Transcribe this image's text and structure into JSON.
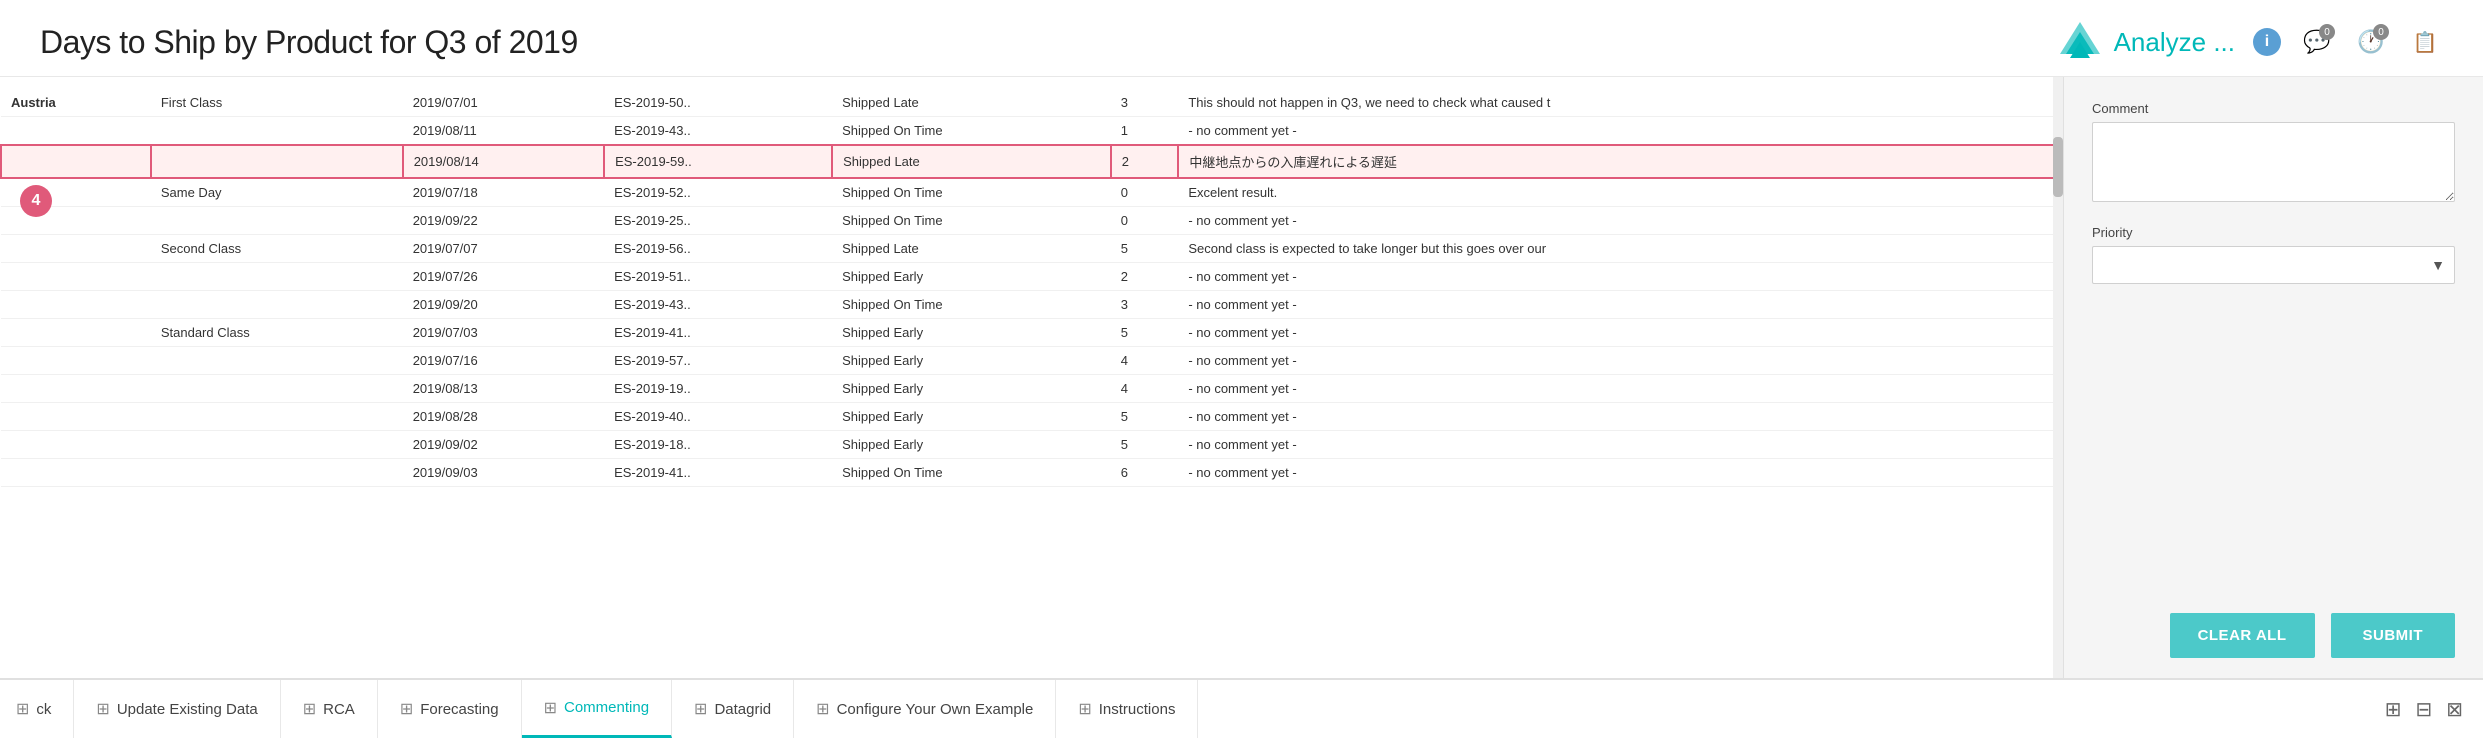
{
  "header": {
    "title": "Days to Ship by Product for Q3 of 2019",
    "analyze_label": "Analyze ...",
    "info_label": "i",
    "badge_comment": "0",
    "badge_clock": "0"
  },
  "table": {
    "rows": [
      {
        "group": "Austria",
        "subgroup": "First Class",
        "date": "2019/07/01",
        "order": "ES-2019-50..",
        "status": "Shipped Late",
        "days": "3",
        "comment": "This should not happen in Q3, we need to check what caused t",
        "highlight": false
      },
      {
        "group": "",
        "subgroup": "",
        "date": "2019/08/11",
        "order": "ES-2019-43..",
        "status": "Shipped On Time",
        "days": "1",
        "comment": "- no comment yet -",
        "highlight": false
      },
      {
        "group": "",
        "subgroup": "",
        "date": "2019/08/14",
        "order": "ES-2019-59..",
        "status": "Shipped Late",
        "days": "2",
        "comment": "中継地点からの入庫遅れによる遅延",
        "highlight": true
      },
      {
        "group": "",
        "subgroup": "Same Day",
        "date": "2019/07/18",
        "order": "ES-2019-52..",
        "status": "Shipped On Time",
        "days": "0",
        "comment": "Excelent result.",
        "highlight": false
      },
      {
        "group": "",
        "subgroup": "",
        "date": "2019/09/22",
        "order": "ES-2019-25..",
        "status": "Shipped On Time",
        "days": "0",
        "comment": "- no comment yet -",
        "highlight": false
      },
      {
        "group": "",
        "subgroup": "Second Class",
        "date": "2019/07/07",
        "order": "ES-2019-56..",
        "status": "Shipped Late",
        "days": "5",
        "comment": "Second class is expected to take longer but this goes over our",
        "highlight": false
      },
      {
        "group": "",
        "subgroup": "",
        "date": "2019/07/26",
        "order": "ES-2019-51..",
        "status": "Shipped Early",
        "days": "2",
        "comment": "- no comment yet -",
        "highlight": false
      },
      {
        "group": "",
        "subgroup": "",
        "date": "2019/09/20",
        "order": "ES-2019-43..",
        "status": "Shipped On Time",
        "days": "3",
        "comment": "- no comment yet -",
        "highlight": false
      },
      {
        "group": "",
        "subgroup": "Standard\nClass",
        "date": "2019/07/03",
        "order": "ES-2019-41..",
        "status": "Shipped Early",
        "days": "5",
        "comment": "- no comment yet -",
        "highlight": false
      },
      {
        "group": "",
        "subgroup": "",
        "date": "2019/07/16",
        "order": "ES-2019-57..",
        "status": "Shipped Early",
        "days": "4",
        "comment": "- no comment yet -",
        "highlight": false
      },
      {
        "group": "",
        "subgroup": "",
        "date": "2019/08/13",
        "order": "ES-2019-19..",
        "status": "Shipped Early",
        "days": "4",
        "comment": "- no comment yet -",
        "highlight": false
      },
      {
        "group": "",
        "subgroup": "",
        "date": "2019/08/28",
        "order": "ES-2019-40..",
        "status": "Shipped Early",
        "days": "5",
        "comment": "- no comment yet -",
        "highlight": false
      },
      {
        "group": "",
        "subgroup": "",
        "date": "2019/09/02",
        "order": "ES-2019-18..",
        "status": "Shipped Early",
        "days": "5",
        "comment": "- no comment yet -",
        "highlight": false
      },
      {
        "group": "",
        "subgroup": "",
        "date": "2019/09/03",
        "order": "ES-2019-41..",
        "status": "Shipped On Time",
        "days": "6",
        "comment": "- no comment yet -",
        "highlight": false
      }
    ],
    "badge": "4"
  },
  "panel": {
    "comment_label": "Comment",
    "comment_placeholder": "",
    "priority_label": "Priority",
    "priority_placeholder": "",
    "clear_label": "CLEAR ALL",
    "submit_label": "SUBMIT"
  },
  "tabs": [
    {
      "label": "ck",
      "icon": "⊞",
      "active": false
    },
    {
      "label": "Update Existing Data",
      "icon": "⊞",
      "active": false
    },
    {
      "label": "RCA",
      "icon": "⊞",
      "active": false
    },
    {
      "label": "Forecasting",
      "icon": "⊞",
      "active": false
    },
    {
      "label": "Commenting",
      "icon": "⊞",
      "active": true
    },
    {
      "label": "Datagrid",
      "icon": "⊞",
      "active": false
    },
    {
      "label": "Configure Your Own Example",
      "icon": "⊞",
      "active": false
    },
    {
      "label": "Instructions",
      "icon": "⊞",
      "active": false
    }
  ],
  "tab_end_icons": [
    "⊞",
    "⊟",
    "⊠"
  ]
}
